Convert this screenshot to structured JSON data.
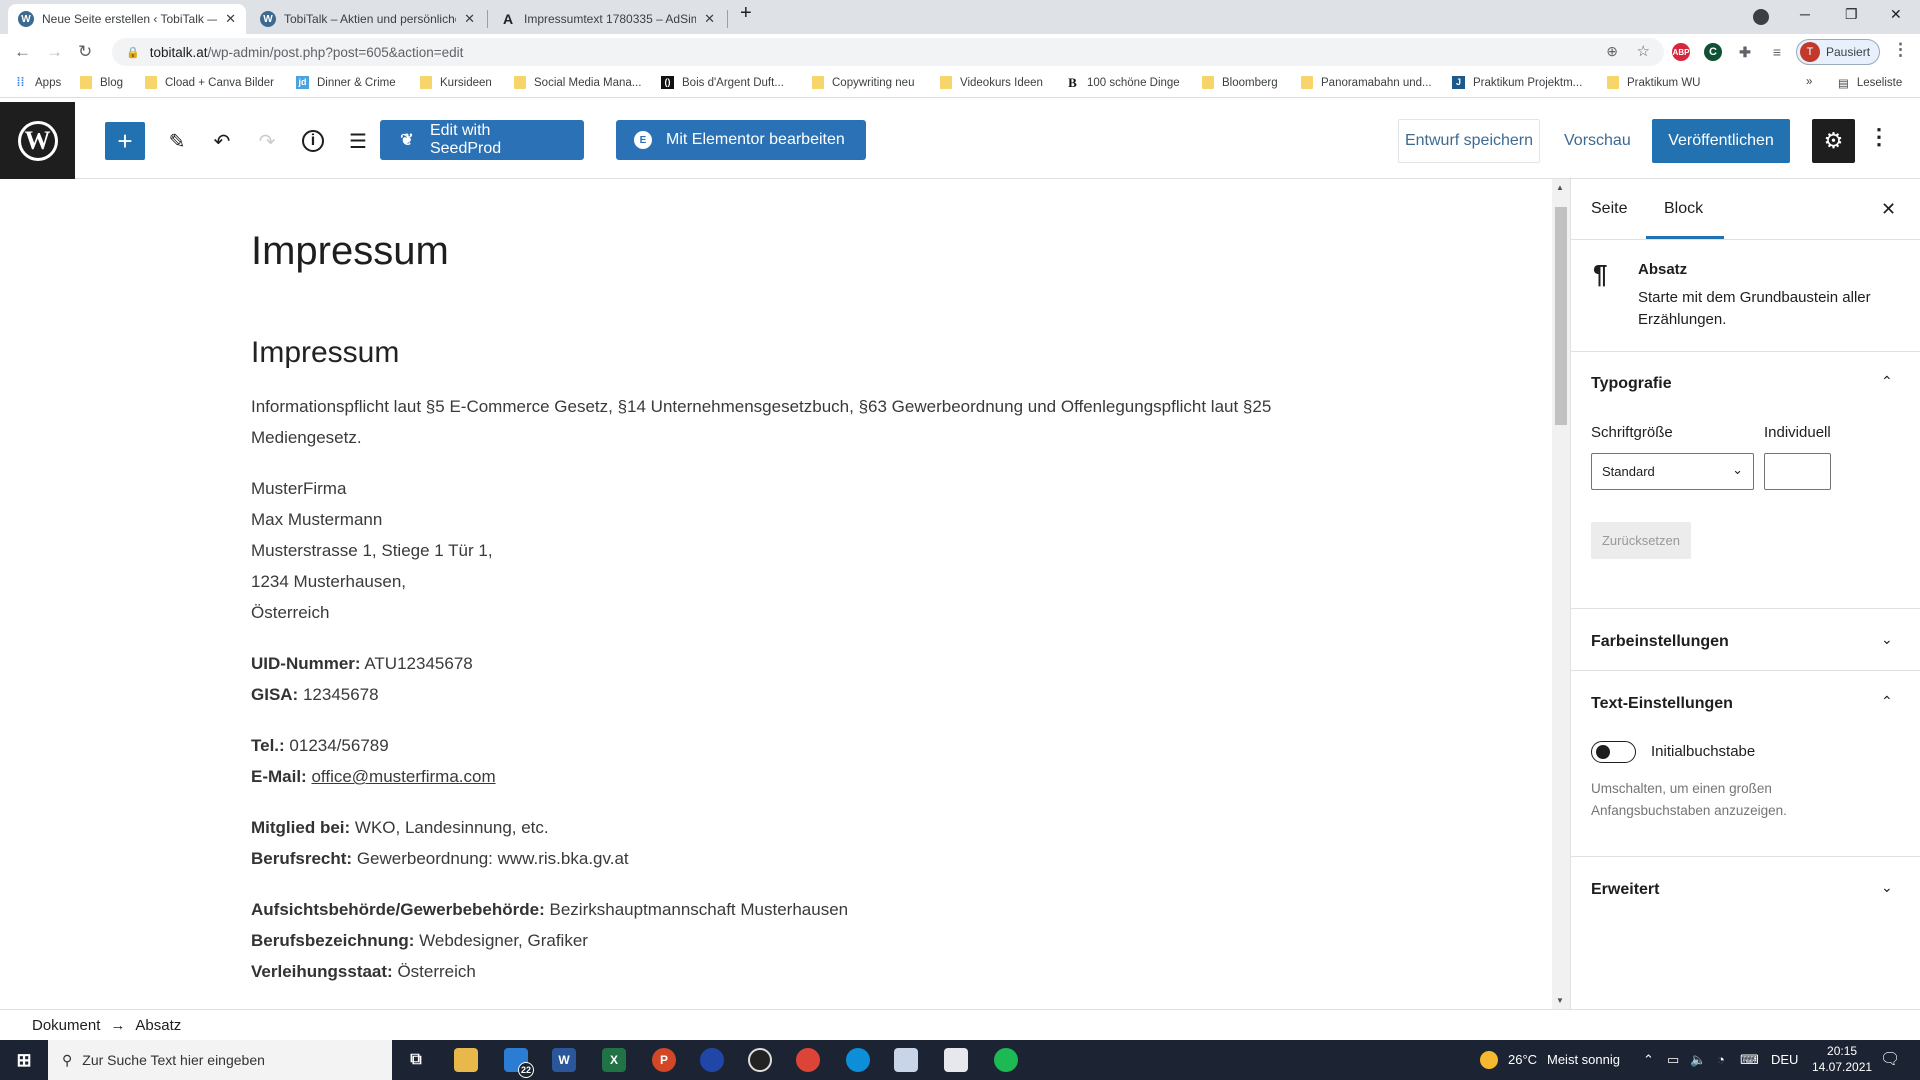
{
  "browser": {
    "tabs": [
      {
        "title": "Neue Seite erstellen ‹ TobiTalk —",
        "icon": "wordpress-icon",
        "active": true
      },
      {
        "title": "TobiTalk – Aktien und persönliche",
        "icon": "wordpress-icon",
        "active": false
      },
      {
        "title": "Impressumtext 1780335 – AdSim",
        "icon": "adsimple-icon",
        "active": false
      }
    ],
    "new_tab": "+",
    "url_domain": "tobitalk.at",
    "url_path": "/wp-admin/post.php?post=605&action=edit",
    "profile_initial": "T",
    "profile_status": "Pausiert",
    "extensions": [
      "ABP",
      "C"
    ],
    "bookmarks": [
      {
        "label": "Apps",
        "icon": "apps-grid-icon"
      },
      {
        "label": "Blog",
        "icon": "folder-icon"
      },
      {
        "label": "Cload + Canva Bilder",
        "icon": "folder-icon"
      },
      {
        "label": "Dinner & Crime",
        "icon": "jd-icon"
      },
      {
        "label": "Kursideen",
        "icon": "folder-icon"
      },
      {
        "label": "Social Media Mana...",
        "icon": "folder-icon"
      },
      {
        "label": "Bois d'Argent Duft...",
        "icon": "site-icon"
      },
      {
        "label": "Copywriting neu",
        "icon": "folder-icon"
      },
      {
        "label": "Videokurs Ideen",
        "icon": "folder-icon"
      },
      {
        "label": "100 schöne Dinge",
        "icon": "b-icon"
      },
      {
        "label": "Bloomberg",
        "icon": "folder-icon"
      },
      {
        "label": "Panoramabahn und...",
        "icon": "folder-icon"
      },
      {
        "label": "Praktikum Projektm...",
        "icon": "j-icon"
      },
      {
        "label": "Praktikum WU",
        "icon": "folder-icon"
      }
    ],
    "bookmarks_overflow": "»",
    "reading_list": "Leseliste"
  },
  "toolbar": {
    "seedprod_label": "Edit with SeedProd",
    "elementor_label": "Mit Elementor bearbeiten",
    "save_draft_label": "Entwurf speichern",
    "preview_label": "Vorschau",
    "publish_label": "Veröffentlichen"
  },
  "document": {
    "title": "Impressum",
    "heading": "Impressum",
    "intro": "Informationspflicht laut §5 E-Commerce Gesetz, §14 Unternehmensgesetzbuch, §63 Gewerbeordnung und Offenlegungspflicht laut §25 Mediengesetz.",
    "address_lines": [
      "MusterFirma",
      "Max Mustermann",
      "Musterstrasse 1, Stiege 1 Tür 1,",
      "1234 Musterhausen,",
      "Österreich"
    ],
    "uid_label": "UID-Nummer:",
    "uid_value": " ATU12345678",
    "gisa_label": "GISA:",
    "gisa_value": " 12345678",
    "tel_label": "Tel.:",
    "tel_value": " 01234/56789",
    "email_label": "E-Mail:",
    "email_value": "office@musterfirma.com",
    "member_label": "Mitglied bei:",
    "member_value": " WKO, Landesinnung, etc.",
    "law_label": "Berufsrecht:",
    "law_value": " Gewerbeordnung: www.ris.bka.gv.at",
    "authority_label": "Aufsichtsbehörde/Gewerbebehörde:",
    "authority_value": " Bezirkshauptmannschaft Musterhausen",
    "job_label": "Berufsbezeichnung:",
    "job_value": " Webdesigner, Grafiker",
    "state_label": "Verleihungsstaat:",
    "state_value": " Österreich"
  },
  "sidebar": {
    "tabs": [
      "Seite",
      "Block"
    ],
    "active_tab": "Block",
    "block_name": "Absatz",
    "block_description": "Starte mit dem Grundbaustein aller Erzählungen.",
    "typography": {
      "title": "Typografie",
      "font_size_label": "Schriftgröße",
      "custom_label": "Individuell",
      "font_size_value": "Standard",
      "custom_value": "",
      "reset_label": "Zurücksetzen"
    },
    "color_settings": "Farbeinstellungen",
    "text_settings": {
      "title": "Text-Einstellungen",
      "dropcap_label": "Initialbuchstabe",
      "dropcap_enabled": false,
      "help": "Umschalten, um einen großen Anfangsbuchstaben anzuzeigen."
    },
    "advanced": "Erweitert"
  },
  "breadcrumb": {
    "root": "Dokument",
    "separator": "→",
    "current": "Absatz"
  },
  "taskbar": {
    "search_placeholder": "Zur Suche Text hier eingeben",
    "mail_badge": "22",
    "weather": "26°C",
    "weather_text": "Meist sonnig",
    "language": "DEU",
    "time": "20:15",
    "date": "14.07.2021"
  }
}
